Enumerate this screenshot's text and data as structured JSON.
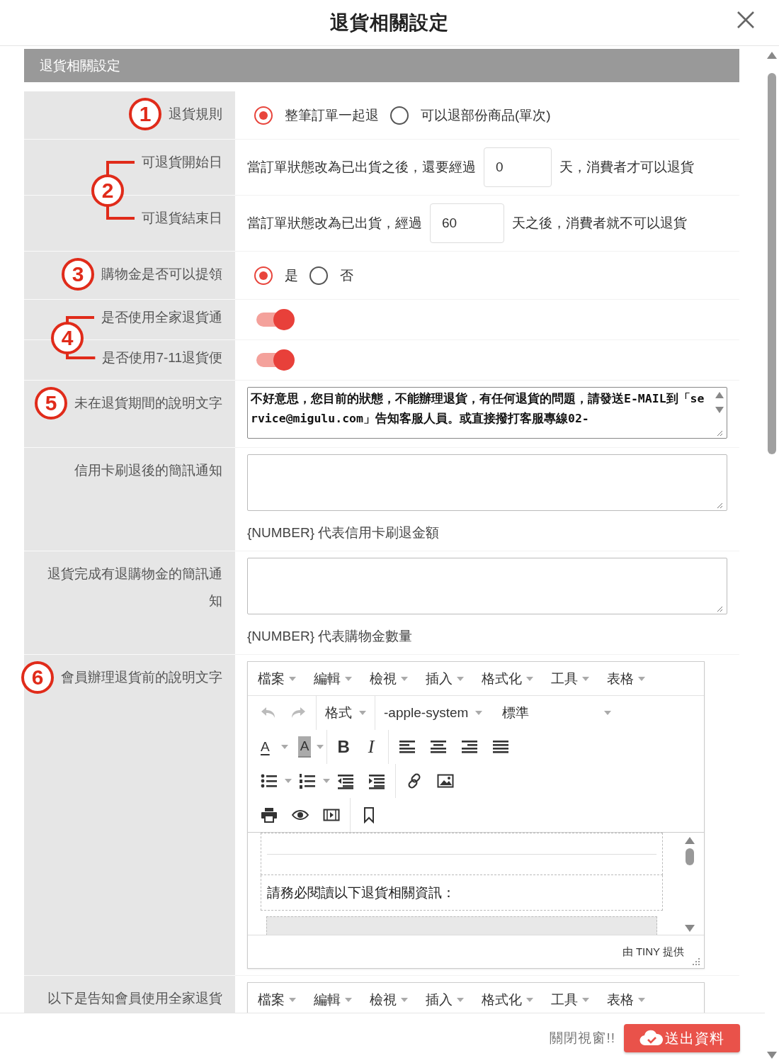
{
  "dialog": {
    "title": "退貨相關設定"
  },
  "panel": {
    "title": "退貨相關設定"
  },
  "rows": [
    {
      "kind": "radio",
      "label": "退貨規則",
      "callout": {
        "number": "1"
      },
      "options": [
        {
          "label": "整筆訂單一起退",
          "selected": true
        },
        {
          "label": "可以退部份商品(單次)",
          "selected": false
        }
      ]
    },
    {
      "kind": "sentence",
      "label": "可退貨開始日",
      "callout": {
        "number": "2",
        "bracket": true
      },
      "before": "當訂單狀態改為已出貨之後，還要經過",
      "value": "0",
      "after": "天，消費者才可以退貨"
    },
    {
      "kind": "sentence",
      "label": "可退貨結束日",
      "before": "當訂單狀態改為已出貨，經過",
      "value": "60",
      "after": "天之後，消費者就不可以退貨"
    },
    {
      "kind": "radio",
      "label": "購物金是否可以提領",
      "callout": {
        "number": "3"
      },
      "options": [
        {
          "label": "是",
          "selected": true
        },
        {
          "label": "否",
          "selected": false
        }
      ]
    },
    {
      "kind": "toggle",
      "label": "是否使用全家退貨通",
      "callout": {
        "number": "4",
        "bracket": true
      },
      "on": true
    },
    {
      "kind": "toggle",
      "label": "是否使用7-11退貨便",
      "on": true
    },
    {
      "kind": "textarea",
      "label": "未在退貨期間的說明文字",
      "callout": {
        "number": "5"
      },
      "value": "不好意思，您目前的狀態，不能辦理退貨，有任何退貨的問題，請發送E-MAIL到「service@migulu.com」告知客服人員。或直接撥打客服專線02-"
    },
    {
      "kind": "textarea",
      "label": "信用卡刷退後的簡訊通知",
      "hint": "{NUMBER} 代表信用卡刷退金額"
    },
    {
      "kind": "textarea",
      "label": "退貨完成有退購物金的簡訊通知",
      "hint": "{NUMBER} 代表購物金數量"
    },
    {
      "kind": "editor",
      "label": "會員辦理退貨前的說明文字",
      "callout": {
        "number": "6"
      },
      "menu": [
        "檔案",
        "編輯",
        "檢視",
        "插入",
        "格式化",
        "工具",
        "表格"
      ],
      "format": "格式",
      "font": "-apple-system",
      "size": "標準",
      "glyphs": {
        "text_color": "A",
        "background_color": "A",
        "bold": "B",
        "italic": "I"
      },
      "content": [
        "請務必閱讀以下退貨相關資訊："
      ],
      "credit": "由 TINY 提供"
    },
    {
      "kind": "editor",
      "label": "以下是告知會員使用全家退貨",
      "menu": [
        "檔案",
        "編輯",
        "檢視",
        "插入",
        "格式化",
        "工具",
        "表格"
      ]
    }
  ],
  "footer": {
    "close": "關閉視窗!!",
    "submit": "送出資料"
  }
}
